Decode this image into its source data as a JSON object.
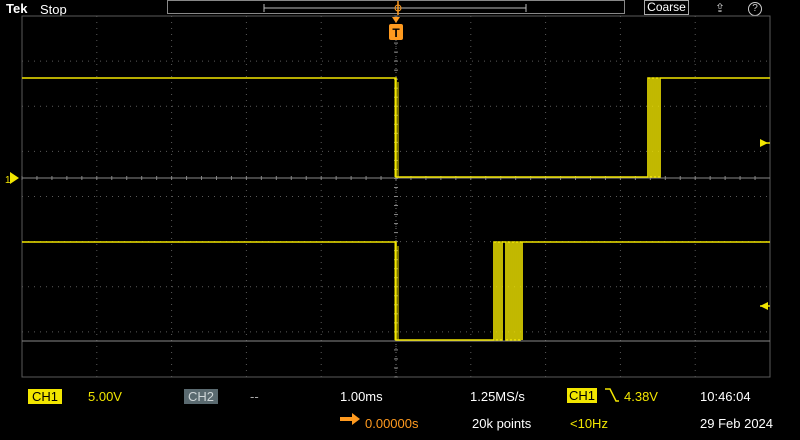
{
  "topbar": {
    "brand": "Tek",
    "acquisition_state": "Stop",
    "coarse_button": "Coarse",
    "help_icon": "help-icon",
    "share_icon": "share-icon"
  },
  "markers": {
    "trigger_label": "T",
    "ch1_marker": "1"
  },
  "status": {
    "ch1_label": "CH1",
    "ch1_scale": "5.00V",
    "ch2_label": "CH2",
    "ch2_scale": "--",
    "horizontal_scale": "1.00ms",
    "sample_rate": "1.25MS/s",
    "trigger_source": "CH1",
    "trigger_level": "4.38V",
    "trigger_position": "0.00000s",
    "record_length": "20k points",
    "trigger_frequency": "<10Hz",
    "time": "10:46:04",
    "date": "29 Feb 2024"
  },
  "colors": {
    "trace": "#f2e600",
    "trigger": "#ff9a1f",
    "grid": "#5a5a5a"
  }
}
